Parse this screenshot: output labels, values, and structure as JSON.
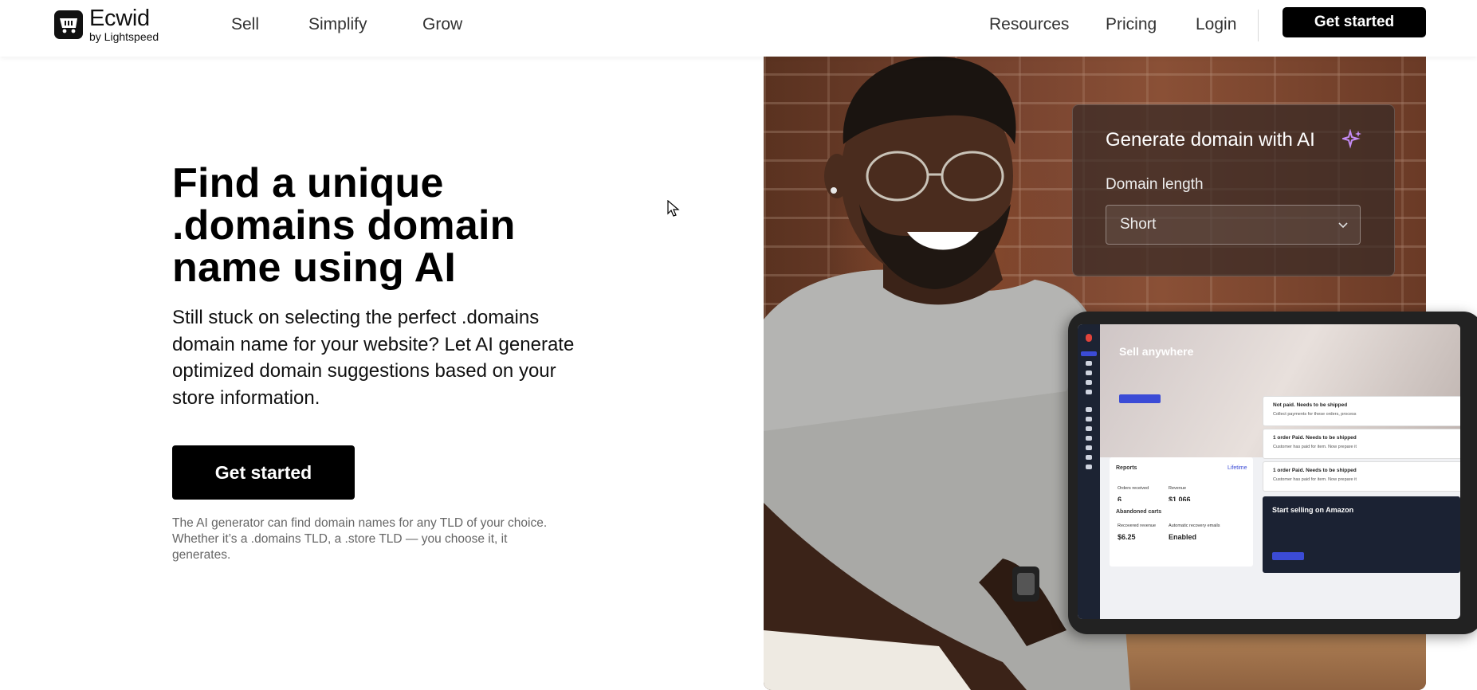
{
  "header": {
    "logo": {
      "name": "Ecwid",
      "sub": "by Lightspeed"
    },
    "nav_left": [
      "Sell",
      "Simplify",
      "Grow"
    ],
    "nav_right": [
      "Resources",
      "Pricing",
      "Login"
    ],
    "cta": "Get started"
  },
  "hero": {
    "title": "Find a unique .domains domain name using AI",
    "subtitle": "Still stuck on selecting the perfect .domains domain name for your website? Let AI generate optimized domain suggestions based on your store information.",
    "cta": "Get started",
    "note": "The AI generator can find domain names for any TLD of your choice. Whether it’s a .domains TLD, a .store TLD — you choose it, it generates."
  },
  "ai_card": {
    "title": "Generate domain with AI",
    "label": "Domain length",
    "selected": "Short"
  },
  "tablet": {
    "banner_title": "Sell anywhere",
    "reports": {
      "title": "Reports",
      "link": "Lifetime",
      "orders_label": "Orders received",
      "orders_value": "6",
      "revenue_label": "Revenue",
      "revenue_value": "$1 066"
    },
    "carts": {
      "title": "Abandoned carts",
      "recovered_label": "Recovered revenue",
      "recovered_value": "$6.25",
      "emails_label": "Automatic recovery emails",
      "emails_value": "Enabled"
    },
    "notifications": [
      {
        "title": "Not paid. Needs to be shipped",
        "sub": "Collect payments for these orders, process"
      },
      {
        "title": "1 order Paid. Needs to be shipped",
        "sub": "Customer has paid for item. Now prepare it"
      },
      {
        "title": "1 order Paid. Needs to be shipped",
        "sub": "Customer has paid for item. Now prepare it"
      }
    ],
    "amazon_title": "Start selling on Amazon"
  },
  "colors": {
    "primary": "#000000",
    "text": "#111111",
    "muted": "#666666",
    "accent_purple": "#c58cf5",
    "app_blue": "#3b4bd6"
  }
}
